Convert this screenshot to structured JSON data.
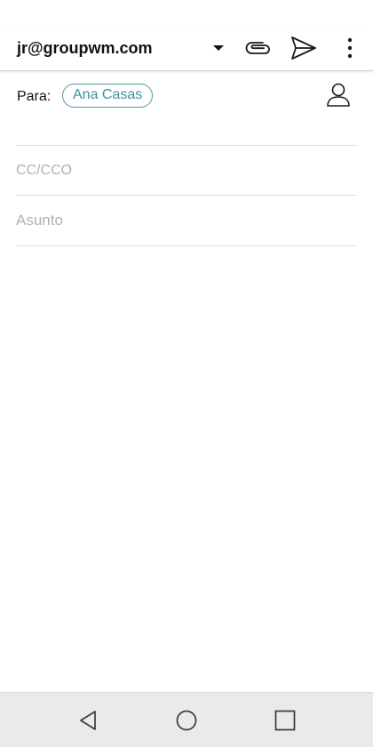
{
  "header": {
    "account_email": "jr@groupwm.com",
    "icons": {
      "dropdown": "chevron-down-icon",
      "attach": "paperclip-icon",
      "send": "send-icon",
      "more": "more-vertical-icon"
    }
  },
  "compose": {
    "to_label": "Para:",
    "recipients": [
      {
        "name": "Ana Casas"
      }
    ],
    "contacts_icon": "person-icon",
    "cc_placeholder": "CC/CCO",
    "cc_value": "",
    "subject_placeholder": "Asunto",
    "subject_value": "",
    "body_value": ""
  },
  "navigation": {
    "icons": [
      "back-icon",
      "home-icon",
      "recents-icon"
    ]
  },
  "colors": {
    "chip_border": "#4a9aa6",
    "chip_text": "#3f8f9b",
    "placeholder": "#b0b0b0",
    "nav_bar_bg": "#e9eaec"
  }
}
